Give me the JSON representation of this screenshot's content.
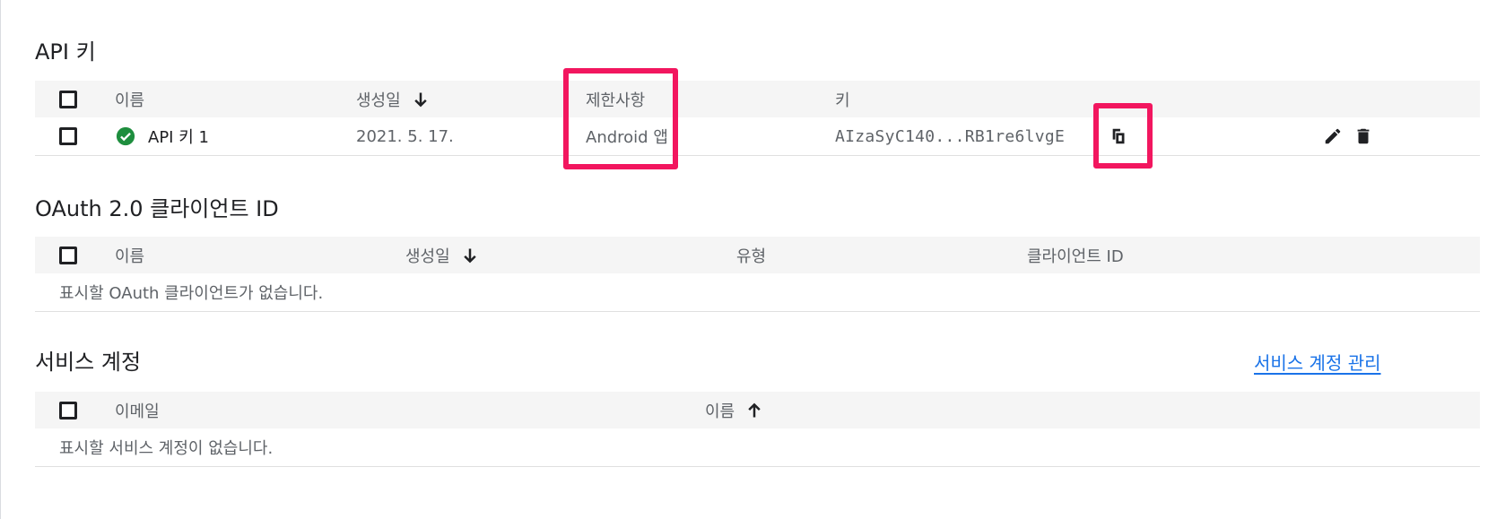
{
  "api_keys": {
    "title": "API 키",
    "columns": {
      "name": "이름",
      "created": "생성일",
      "restrictions": "제한사항",
      "key": "키"
    },
    "rows": [
      {
        "name": "API 키 1",
        "created": "2021. 5. 17.",
        "restrictions": "Android 앱",
        "key": "AIzaSyC140...RB1re6lvgE",
        "status_icon": "check-circle-icon",
        "actions": [
          "copy-icon",
          "edit-icon",
          "delete-icon"
        ]
      }
    ]
  },
  "oauth": {
    "title": "OAuth 2.0 클라이언트 ID",
    "columns": {
      "name": "이름",
      "created": "생성일",
      "type": "유형",
      "client_id": "클라이언트 ID"
    },
    "empty_message": "표시할 OAuth 클라이언트가 없습니다."
  },
  "service_accounts": {
    "title": "서비스 계정",
    "manage_link": "서비스 계정 관리",
    "columns": {
      "email": "이메일",
      "name": "이름"
    },
    "empty_message": "표시할 서비스 계정이 없습니다."
  },
  "colors": {
    "highlight": "#f2165f",
    "link": "#1a73e8",
    "success": "#1e8e3e",
    "header_bg": "#f5f5f5"
  }
}
